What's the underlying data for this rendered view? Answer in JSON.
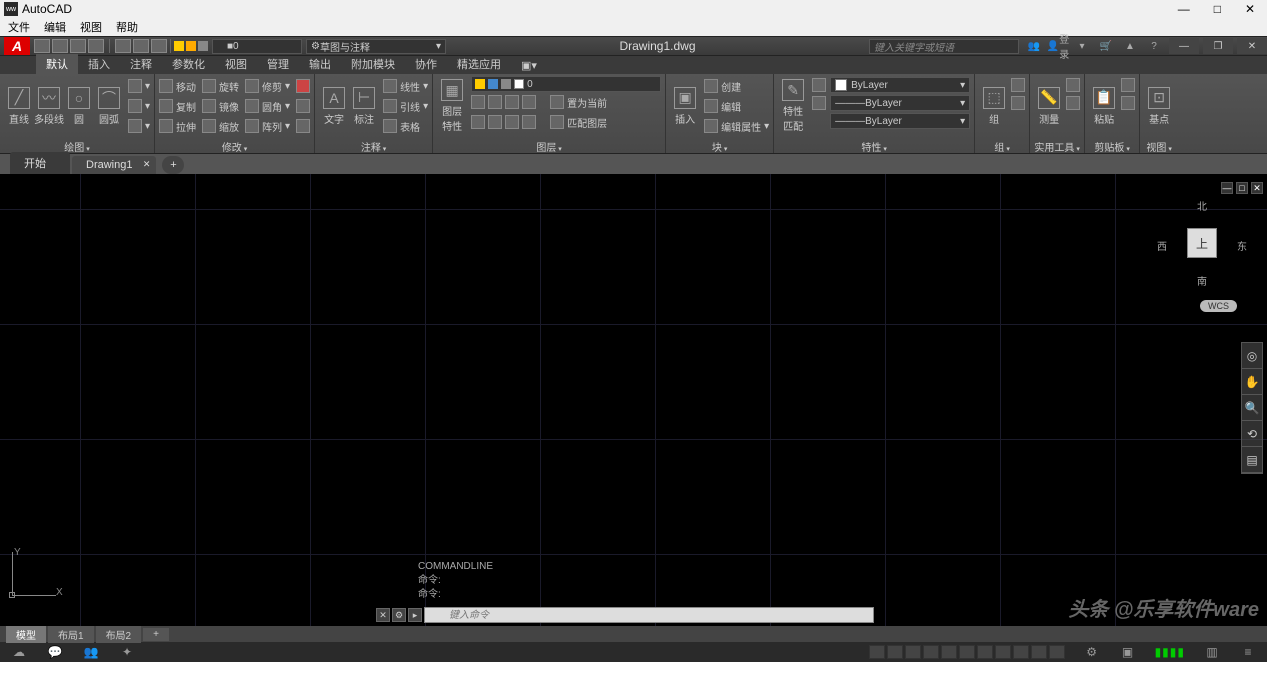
{
  "app": {
    "title": "AutoCAD",
    "menus": [
      "文件",
      "编辑",
      "视图",
      "帮助"
    ]
  },
  "window_controls": {
    "min": "—",
    "max": "□",
    "close": "✕"
  },
  "qat": {
    "layer_value": "0",
    "workspace": "草图与注释",
    "doc_title": "Drawing1.dwg",
    "search_ph": "键入关键字或短语",
    "login": "登录",
    "doc_ctrl": {
      "min": "—",
      "restore": "❐",
      "close": "✕"
    }
  },
  "ribbon_tabs": [
    "默认",
    "插入",
    "注释",
    "参数化",
    "视图",
    "管理",
    "输出",
    "附加模块",
    "协作",
    "精选应用"
  ],
  "ribbon": {
    "draw": {
      "title": "绘图",
      "line": "直线",
      "pline": "多段线",
      "circle": "圆",
      "arc": "圆弧"
    },
    "modify": {
      "title": "修改",
      "move": "移动",
      "rotate": "旋转",
      "trim": "修剪",
      "copy": "复制",
      "mirror": "镜像",
      "fillet": "圆角",
      "stretch": "拉伸",
      "scale": "缩放",
      "array": "阵列"
    },
    "annot": {
      "title": "注释",
      "text": "文字",
      "dim": "标注",
      "table": "表格",
      "linear": "线性",
      "leader": "引线"
    },
    "layer": {
      "title": "图层",
      "props": "图层\n特性",
      "current": "0",
      "setcur": "置为当前",
      "match": "匹配图层"
    },
    "block": {
      "title": "块",
      "insert": "插入",
      "create": "创建",
      "edit": "编辑",
      "attr": "编辑属性"
    },
    "prop": {
      "title": "特性",
      "match": "特性\n匹配",
      "bylayer": "ByLayer"
    },
    "group": {
      "title": "组",
      "group": "组"
    },
    "util": {
      "title": "实用工具",
      "measure": "测量"
    },
    "clip": {
      "title": "剪贴板",
      "paste": "粘贴"
    },
    "view": {
      "title": "视图",
      "base": "基点"
    }
  },
  "filetabs": {
    "start": "开始",
    "drawing": "Drawing1"
  },
  "viewcube": {
    "top": "上",
    "n": "北",
    "s": "南",
    "e": "东",
    "w": "西",
    "wcs": "WCS"
  },
  "ucs": {
    "y": "Y",
    "x": "X"
  },
  "cmd": {
    "l1": "COMMANDLINE",
    "l2": "命令:",
    "l3": "命令:",
    "ph": "键入命令"
  },
  "layouts": {
    "model": "模型",
    "l1": "布局1",
    "l2": "布局2",
    "plus": "+"
  },
  "watermark": "头条 @乐享软件ware"
}
